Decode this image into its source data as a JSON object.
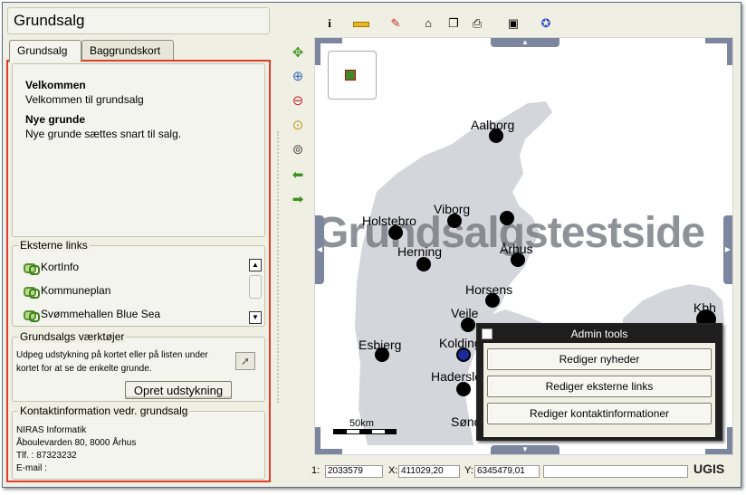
{
  "page_title": "Grundsalg",
  "tabs": [
    "Grundsalg",
    "Baggrundskort"
  ],
  "welcome": {
    "heading": "Velkommen",
    "text": "Velkommen til grundsalg"
  },
  "news": {
    "heading": "Nye grunde",
    "text": "Nye grunde sættes snart til salg."
  },
  "external_links": {
    "legend": "Eksterne links",
    "items": [
      "KortInfo",
      "Kommuneplan",
      "Svømmehallen Blue Sea"
    ]
  },
  "tools": {
    "legend": "Grundsalgs værktøjer",
    "text": "Udpeg udstykning på kortet eller på listen under kortet for at se de enkelte grunde.",
    "create_button": "Opret udstykning"
  },
  "contact": {
    "legend": "Kontaktinformation vedr. grundsalg",
    "lines": [
      "NIRAS Informatik",
      "Åboulevarden 80, 8000 Århus",
      "Tlf. : 87323232",
      "E-mail :"
    ]
  },
  "map": {
    "watermark": "Grundsalgstestside",
    "scale_label": "50km",
    "cities": [
      "Aalborg",
      "Holstebro",
      "Viborg",
      "Herning",
      "Århus",
      "Horsens",
      "Vejle",
      "Esbjerg",
      "Kolding",
      "Haderslev",
      "Sønderborg",
      "Kbh"
    ]
  },
  "admin": {
    "title": "Admin tools",
    "buttons": [
      "Rediger nyheder",
      "Rediger eksterne links",
      "Rediger kontaktinformationer"
    ]
  },
  "status": {
    "scale_label": "1:",
    "scale_value": "2033579",
    "x_label": "X:",
    "x_value": "411029,20",
    "y_label": "Y:",
    "y_value": "6345479,01",
    "logo": "UGIS"
  },
  "toolbar": {
    "info_glyph": "i"
  }
}
